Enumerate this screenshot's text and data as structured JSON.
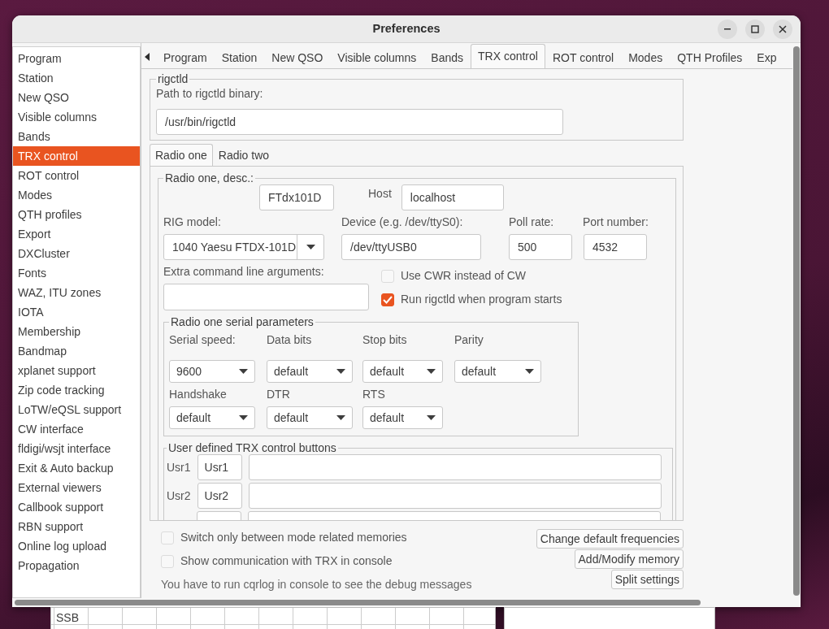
{
  "window": {
    "title": "Preferences"
  },
  "sidebar": {
    "items": [
      {
        "label": "Program",
        "selected": false
      },
      {
        "label": "Station",
        "selected": false
      },
      {
        "label": "New QSO",
        "selected": false
      },
      {
        "label": "Visible columns",
        "selected": false
      },
      {
        "label": "Bands",
        "selected": false
      },
      {
        "label": "TRX control",
        "selected": true
      },
      {
        "label": "ROT control",
        "selected": false
      },
      {
        "label": "Modes",
        "selected": false
      },
      {
        "label": "QTH profiles",
        "selected": false
      },
      {
        "label": "Export",
        "selected": false
      },
      {
        "label": "DXCluster",
        "selected": false
      },
      {
        "label": "Fonts",
        "selected": false
      },
      {
        "label": "WAZ, ITU zones",
        "selected": false
      },
      {
        "label": "IOTA",
        "selected": false
      },
      {
        "label": "Membership",
        "selected": false
      },
      {
        "label": "Bandmap",
        "selected": false
      },
      {
        "label": "xplanet support",
        "selected": false
      },
      {
        "label": "Zip code tracking",
        "selected": false
      },
      {
        "label": "LoTW/eQSL support",
        "selected": false
      },
      {
        "label": "CW interface",
        "selected": false
      },
      {
        "label": "fldigi/wsjt interface",
        "selected": false
      },
      {
        "label": "Exit & Auto backup",
        "selected": false
      },
      {
        "label": "External viewers",
        "selected": false
      },
      {
        "label": "Callbook support",
        "selected": false
      },
      {
        "label": "RBN support",
        "selected": false
      },
      {
        "label": "Online log upload",
        "selected": false
      },
      {
        "label": "Propagation",
        "selected": false
      }
    ]
  },
  "tabs": [
    {
      "label": "Program",
      "selected": false
    },
    {
      "label": "Station",
      "selected": false
    },
    {
      "label": "New QSO",
      "selected": false
    },
    {
      "label": "Visible columns",
      "selected": false
    },
    {
      "label": "Bands",
      "selected": false
    },
    {
      "label": "TRX control",
      "selected": true
    },
    {
      "label": "ROT control",
      "selected": false
    },
    {
      "label": "Modes",
      "selected": false
    },
    {
      "label": "QTH Profiles",
      "selected": false
    },
    {
      "label": "Exp",
      "selected": false
    }
  ],
  "rigctld": {
    "title": "rigctld",
    "path_label": "Path to rigctld binary:",
    "path": "/usr/bin/rigctld"
  },
  "radio_tabs": [
    {
      "label": "Radio one",
      "selected": true
    },
    {
      "label": "Radio two",
      "selected": false
    }
  ],
  "radio": {
    "title": "Radio one, desc.:",
    "description": "FTdx101D",
    "host_label": "Host",
    "host": "localhost",
    "rig_model_label": "RIG model:",
    "rig_model": "1040 Yaesu FTDX-101D",
    "device_label": "Device (e.g. /dev/ttyS0):",
    "device": "/dev/ttyUSB0",
    "poll_rate_label": "Poll rate:",
    "poll_rate": "500",
    "port_label": "Port number:",
    "port": "4532",
    "extra_args_label": "Extra command line arguments:",
    "options": [
      {
        "label": "Use CWR instead of CW",
        "checked": false
      },
      {
        "label": "Run rigctld when program starts",
        "checked": true
      }
    ],
    "serial": {
      "title": "Radio one serial parameters",
      "fields": [
        {
          "label": "Serial speed:",
          "value": "9600"
        },
        {
          "label": "Data bits",
          "value": "default"
        },
        {
          "label": "Stop bits",
          "value": "default"
        },
        {
          "label": "Parity",
          "value": "default"
        },
        {
          "label": "Handshake",
          "value": "default"
        },
        {
          "label": "DTR",
          "value": "default"
        },
        {
          "label": "RTS",
          "value": "default"
        }
      ]
    },
    "user_buttons": {
      "title": "User defined TRX control buttons",
      "rows": [
        {
          "label": "Usr1",
          "name": "Usr1"
        },
        {
          "label": "Usr2",
          "name": "Usr2"
        }
      ]
    }
  },
  "bottom_options": [
    {
      "label": "Switch only between mode related memories",
      "checked": false
    },
    {
      "label": "Show communication with TRX in console",
      "checked": false
    }
  ],
  "note": "You have to run cqrlog in console to see the debug messages",
  "buttons": [
    "Change default frequencies",
    "Add/Modify memory",
    "Split settings"
  ],
  "background_window": {
    "row_label": "SSB"
  }
}
